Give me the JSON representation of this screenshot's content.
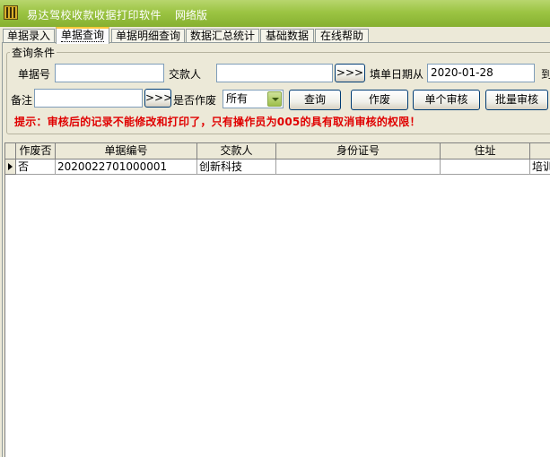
{
  "window": {
    "title": "易达驾校收款收据打印软件",
    "edition": "网络版"
  },
  "tabs": [
    {
      "label": "单据录入",
      "active": false
    },
    {
      "label": "单据查询",
      "active": true
    },
    {
      "label": "单据明细查询",
      "active": false
    },
    {
      "label": "数据汇总统计",
      "active": false
    },
    {
      "label": "基础数据",
      "active": false
    },
    {
      "label": "在线帮助",
      "active": false
    }
  ],
  "query": {
    "group_title": "查询条件",
    "receipt_no_label": "单据号",
    "receipt_no_value": "",
    "payer_label": "交款人",
    "payer_value": "",
    "payer_picker_label": ">>>",
    "date_from_label": "填单日期从",
    "date_from_value": "2020-01-28",
    "date_to_label": "到",
    "remark_label": "备注",
    "remark_value": "",
    "remark_picker_label": ">>>",
    "void_label": "是否作废",
    "void_value": "所有",
    "buttons": {
      "search": "查询",
      "void": "作废",
      "single_audit": "单个审核",
      "batch_audit": "批量审核"
    }
  },
  "hint": "提示：审核后的记录不能修改和打印了，只有操作员为005的具有取消审核的权限！",
  "grid": {
    "columns": [
      "作废否",
      "单据编号",
      "交款人",
      "身份证号",
      "住址",
      ""
    ],
    "rows": [
      [
        "否",
        "2020022701000001",
        "创新科技",
        "",
        "",
        "培训"
      ]
    ]
  },
  "colors": {
    "titlebar": "#9cc443",
    "hint": "#e00000",
    "button_border": "#003c74"
  }
}
